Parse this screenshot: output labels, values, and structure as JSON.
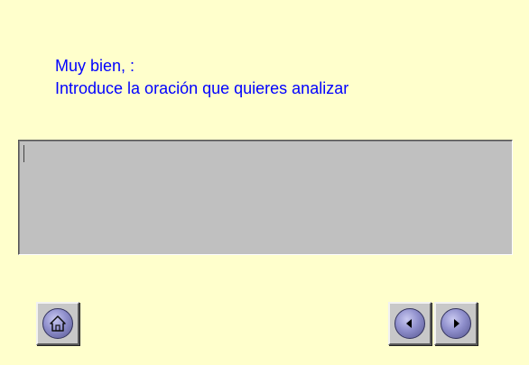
{
  "prompt": {
    "line1": "Muy bien, :",
    "line2": "Introduce la oración que quieres analizar"
  },
  "input": {
    "value": ""
  },
  "nav": {
    "home_icon": "home-icon",
    "prev_icon": "arrow-left-icon",
    "next_icon": "arrow-right-icon"
  },
  "colors": {
    "background": "#ffffcc",
    "prompt_text": "#0000ff",
    "input_background": "#c0c0c0",
    "button_face": "#c8c8c8",
    "icon_circle": "#8f8fcc"
  }
}
